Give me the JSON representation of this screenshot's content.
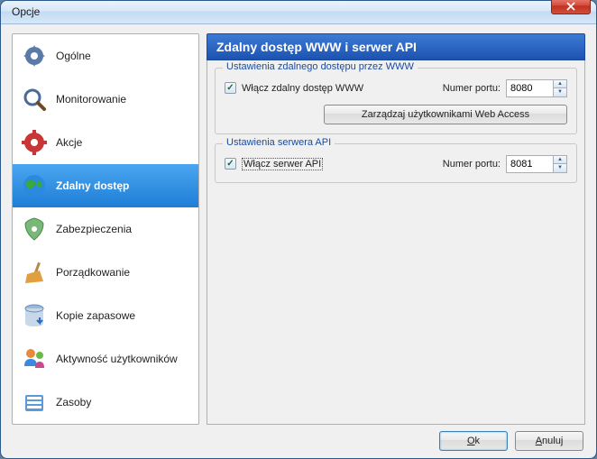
{
  "window": {
    "title": "Opcje"
  },
  "sidebar": {
    "items": [
      {
        "label": "Ogólne",
        "icon": "gear-icon"
      },
      {
        "label": "Monitorowanie",
        "icon": "search-icon"
      },
      {
        "label": "Akcje",
        "icon": "cog-icon"
      },
      {
        "label": "Zdalny dostęp",
        "icon": "globe-icon"
      },
      {
        "label": "Zabezpieczenia",
        "icon": "shield-icon"
      },
      {
        "label": "Porządkowanie",
        "icon": "broom-icon"
      },
      {
        "label": "Kopie zapasowe",
        "icon": "database-icon"
      },
      {
        "label": "Aktywność użytkowników",
        "icon": "users-icon"
      },
      {
        "label": "Zasoby",
        "icon": "folder-icon"
      }
    ]
  },
  "panel": {
    "title": "Zdalny dostęp WWW i serwer API",
    "www": {
      "group_title": "Ustawienia zdalnego dostępu przez WWW",
      "enable_label": "Włącz zdalny dostęp WWW",
      "port_label": "Numer portu:",
      "port_value": "8080",
      "manage_btn": "Zarządzaj użytkownikami Web Access"
    },
    "api": {
      "group_title": "Ustawienia serwera API",
      "enable_label": "Włącz serwer API",
      "port_label": "Numer portu:",
      "port_value": "8081"
    }
  },
  "footer": {
    "ok": "Ok",
    "cancel": "Anuluj"
  }
}
